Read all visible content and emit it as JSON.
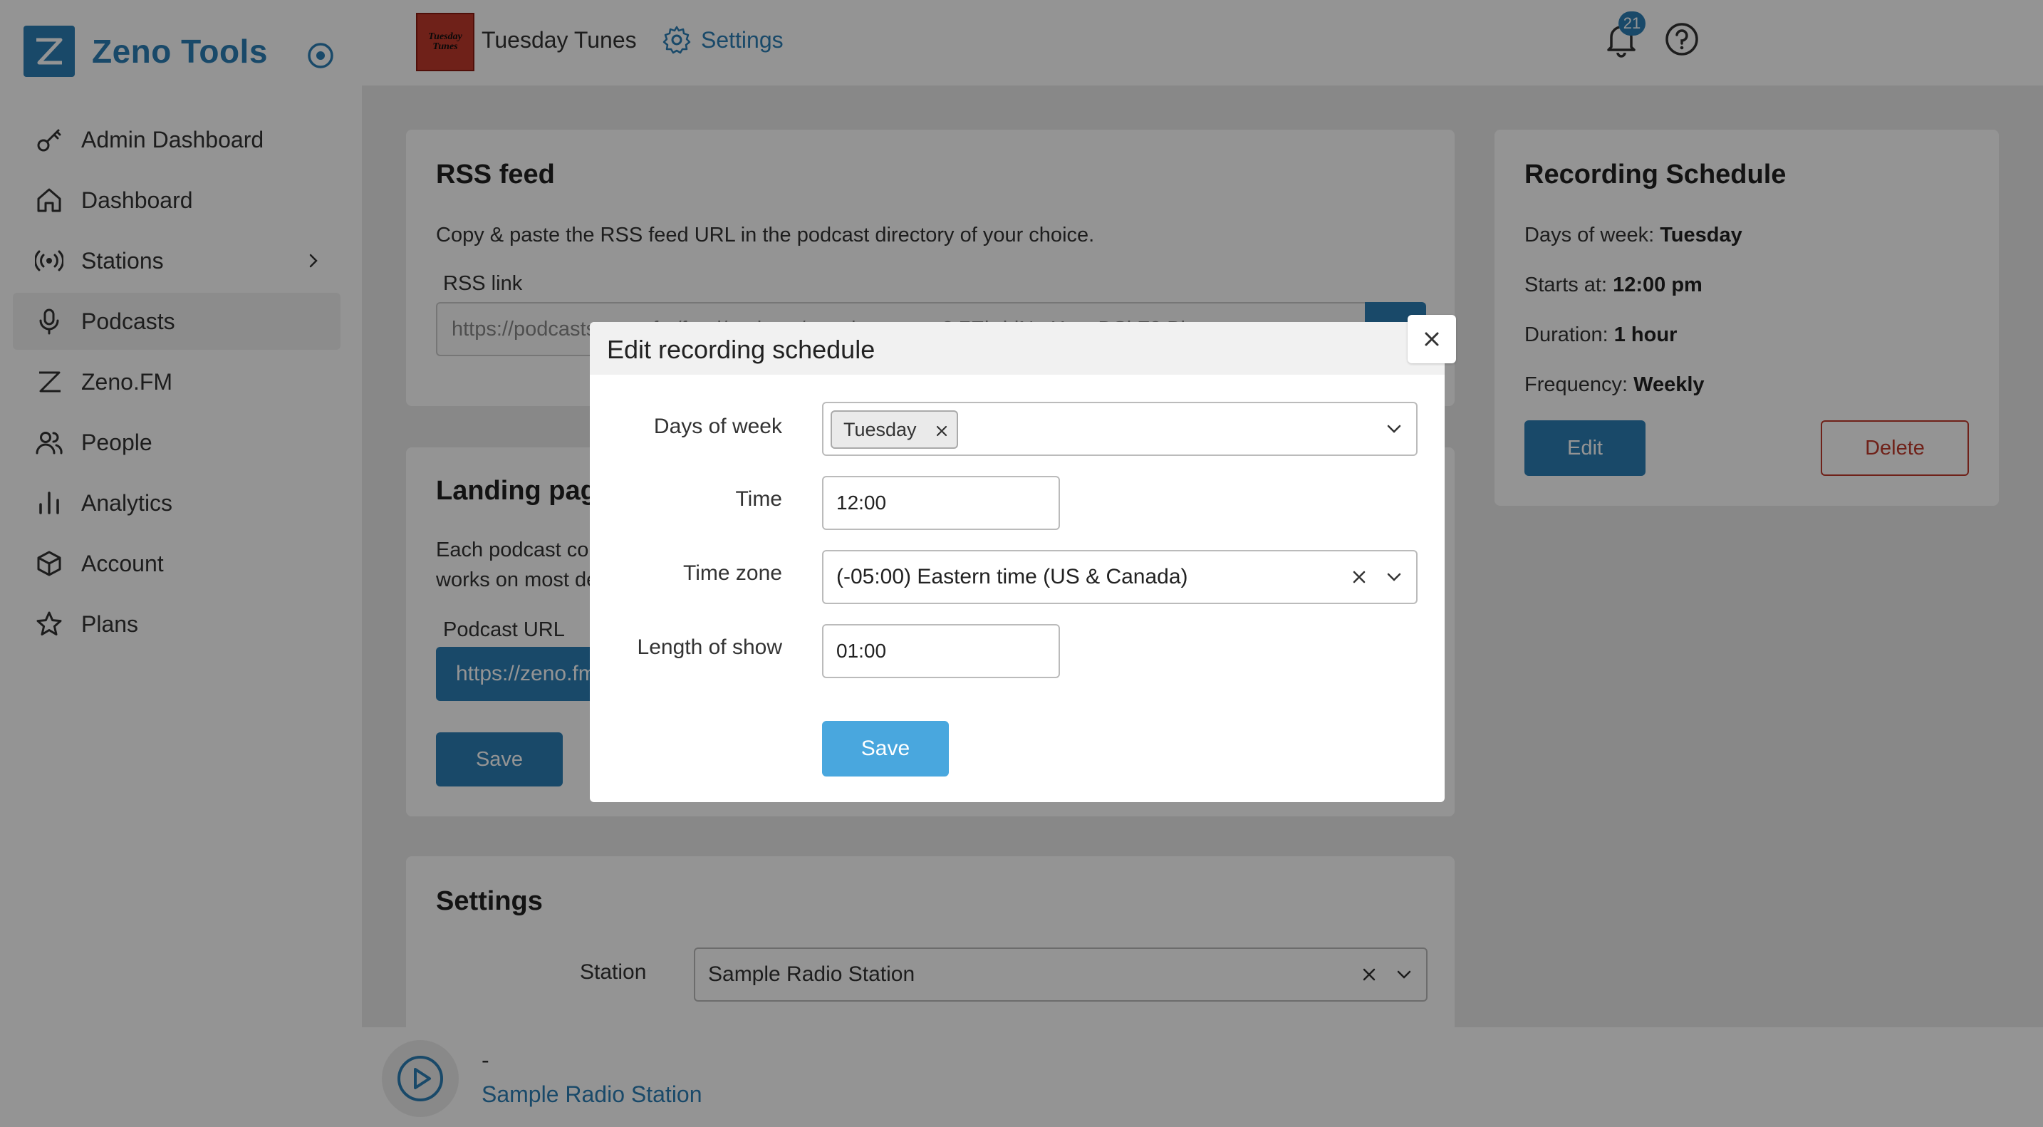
{
  "app": {
    "name": "Zeno Tools"
  },
  "sidebar": {
    "items": [
      {
        "label": "Admin Dashboard",
        "icon": "key-icon"
      },
      {
        "label": "Dashboard",
        "icon": "home-icon"
      },
      {
        "label": "Stations",
        "icon": "broadcast-icon",
        "has_children": true
      },
      {
        "label": "Podcasts",
        "icon": "microphone-icon",
        "active": true
      },
      {
        "label": "Zeno.FM",
        "icon": "zeno-logo-icon"
      },
      {
        "label": "People",
        "icon": "people-icon"
      },
      {
        "label": "Analytics",
        "icon": "bar-chart-icon"
      },
      {
        "label": "Account",
        "icon": "cube-icon"
      },
      {
        "label": "Plans",
        "icon": "star-icon"
      }
    ]
  },
  "topbar": {
    "thumb_text": "Tuesday Tunes",
    "station_name": "Tuesday Tunes",
    "settings_label": "Settings",
    "notifications_count": "21"
  },
  "rss": {
    "title": "RSS feed",
    "description": "Copy & paste the RSS feed URL in the podcast directory of your choice.",
    "link_label": "RSS link",
    "link_value": "https://podcasts.zeno.fm/feed/podcast/tuesday-tunes-8t7Ebd-iNmXaw-DSkF3tBj"
  },
  "landing": {
    "title": "Landing page",
    "description_line1": "Each podcast comes with its own landing page that",
    "description_line2": "works on most devices.",
    "url_label": "Podcast URL",
    "url_value": "https://zeno.fm/podcast/tuesday-tunes/",
    "save_label": "Save"
  },
  "settings_card": {
    "title": "Settings",
    "station_label": "Station",
    "station_value": "Sample Radio Station"
  },
  "schedule": {
    "title": "Recording Schedule",
    "days_label": "Days of week:",
    "days_value": "Tuesday",
    "starts_label": "Starts at:",
    "starts_value": "12:00 pm",
    "duration_label": "Duration:",
    "duration_value": "1 hour",
    "frequency_label": "Frequency:",
    "frequency_value": "Weekly",
    "edit_label": "Edit",
    "delete_label": "Delete"
  },
  "player": {
    "track": "-",
    "station": "Sample Radio Station"
  },
  "modal": {
    "title": "Edit recording schedule",
    "days_label": "Days of week",
    "days_selected": [
      "Tuesday"
    ],
    "time_label": "Time",
    "time_value": "12:00",
    "timezone_label": "Time zone",
    "timezone_value": "(-05:00) Eastern time (US & Canada)",
    "length_label": "Length of show",
    "length_value": "01:00",
    "save_label": "Save"
  },
  "colors": {
    "brand": "#2b7fb6",
    "save_modal": "#49a7de",
    "danger": "#c0392b"
  }
}
